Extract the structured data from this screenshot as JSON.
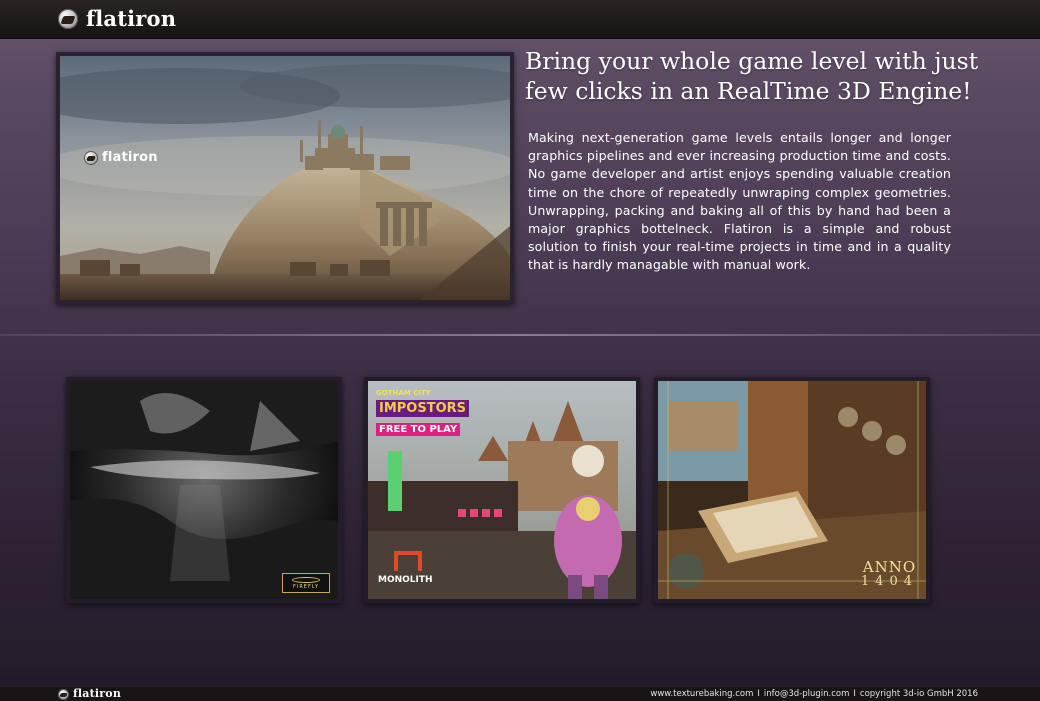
{
  "header": {
    "brand_name": "flatiron",
    "logo_icon": "flatiron-logo-icon"
  },
  "hero": {
    "image_description_icon": "desert-citadel-render",
    "watermark": "flatiron",
    "headline": "Bring your whole game level with just few clicks in an RealTime 3D Engine!",
    "body": "Making next-generation game levels entails longer and longer graphics pipelines and ever increasing production time and costs. No game developer and artist enjoys spending valuable creation time on the chore of repeatedly unwraping complex geometries. Unwrapping, packing and baking all of this by hand had been a major graphics bottelneck. Flatiron is a simple and robust solution to finish your real-time projects in time and in a quality that is hardly managable with manual work."
  },
  "showcase": [
    {
      "badge": "FIREFLY"
    },
    {
      "title_line1": "GOTHAM CITY",
      "title_line2": "IMPOSTORS",
      "title_line3": "FREE TO PLAY",
      "badge": "MONOLITH"
    },
    {
      "badge_line1": "ANNO",
      "badge_line2": "1404"
    }
  ],
  "footer": {
    "brand_name": "flatiron",
    "website": "www.texturebaking.com",
    "email": "info@3d-plugin.com",
    "copyright": "copyright 3d-io GmbH 2016",
    "separator": "I"
  },
  "colors": {
    "background_top": "#6b5670",
    "background_bottom": "#231a29",
    "topbar": "#1e1918",
    "text": "#ffffff"
  }
}
